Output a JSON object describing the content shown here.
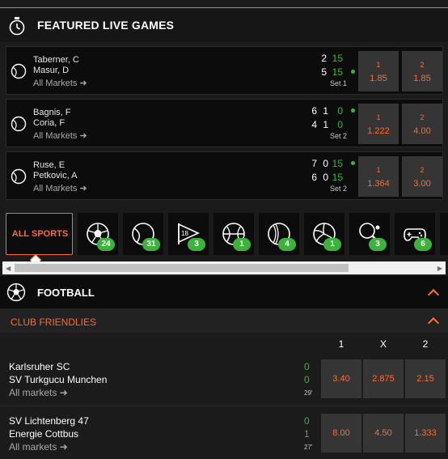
{
  "featured": {
    "title": "FEATURED LIVE GAMES",
    "games": [
      {
        "player1": "Taberner, C",
        "player2": "Masur, D",
        "p1_sets": [
          "2"
        ],
        "p1_points": "15",
        "p2_sets": [
          "5"
        ],
        "p2_points": "15",
        "set_label": "Set 1",
        "markets": "All Markets",
        "odds": [
          {
            "label": "1",
            "value": "1.85"
          },
          {
            "label": "2",
            "value": "1.85"
          }
        ]
      },
      {
        "player1": "Bagnis, F",
        "player2": "Coria, F",
        "p1_sets": [
          "6",
          "1"
        ],
        "p1_points": "0",
        "p2_sets": [
          "4",
          "1"
        ],
        "p2_points": "0",
        "set_label": "Set 2",
        "markets": "All Markets",
        "odds": [
          {
            "label": "1",
            "value": "1.222"
          },
          {
            "label": "2",
            "value": "4.00"
          }
        ]
      },
      {
        "player1": "Ruse, E",
        "player2": "Petkovic, A",
        "p1_sets": [
          "7",
          "0"
        ],
        "p1_points": "15",
        "p2_sets": [
          "6",
          "0"
        ],
        "p2_points": "15",
        "set_label": "Set 2",
        "markets": "All Markets",
        "odds": [
          {
            "label": "1",
            "value": "1.364"
          },
          {
            "label": "2",
            "value": "3.00"
          }
        ]
      }
    ]
  },
  "sports_nav": {
    "all_label": "ALL SPORTS",
    "items": [
      {
        "icon": "soccer-ball-icon",
        "count": "24"
      },
      {
        "icon": "tennis-ball-icon",
        "count": "31"
      },
      {
        "icon": "golf-flag-icon",
        "count": "3",
        "flag_text": "18"
      },
      {
        "icon": "basketball-icon",
        "count": "1"
      },
      {
        "icon": "cricket-ball-icon",
        "count": "4"
      },
      {
        "icon": "volleyball-icon",
        "count": "1"
      },
      {
        "icon": "table-tennis-icon",
        "count": "3"
      },
      {
        "icon": "gamepad-icon",
        "count": "6"
      }
    ]
  },
  "football": {
    "title": "FOOTBALL",
    "league": "CLUB FRIENDLIES",
    "columns": [
      "1",
      "X",
      "2"
    ],
    "matches": [
      {
        "home": "Karlsruher SC",
        "away": "SV Turkgucu Munchen",
        "home_score": "0",
        "away_score": "0",
        "time": "29'",
        "markets": "All markets",
        "odds": [
          "3.40",
          "2.875",
          "2.15"
        ]
      },
      {
        "home": "SV Lichtenberg 47",
        "away": "Energie Cottbus",
        "home_score": "0",
        "away_score": "1",
        "time": "27'",
        "markets": "All markets",
        "odds": [
          "8.00",
          "4.50",
          "1.333"
        ]
      }
    ]
  },
  "colors": {
    "accent": "#ff6b2c",
    "live_green": "#3cb43c",
    "background": "#1b1b1b",
    "card": "#0c0c0c",
    "button": "#353535"
  }
}
